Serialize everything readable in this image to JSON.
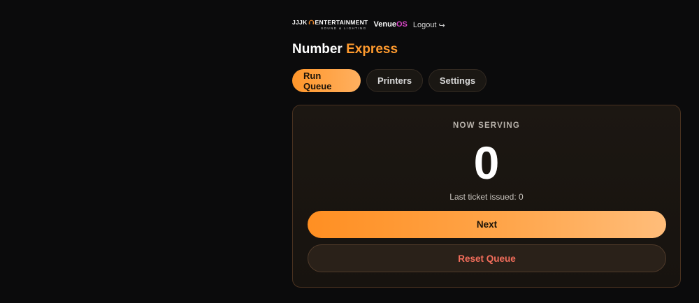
{
  "header": {
    "logo_main_left": "JJJK",
    "logo_main_right": "ENTERTAINMENT",
    "logo_sub": "SOUND & LIGHTING",
    "venue_prefix": "Venue",
    "venue_suffix": "OS",
    "logout_label": "Logout",
    "logout_icon": "↪"
  },
  "title": {
    "main": "Number",
    "accent": "Express"
  },
  "tabs": [
    {
      "label": "Run Queue",
      "active": true
    },
    {
      "label": "Printers",
      "active": false
    },
    {
      "label": "Settings",
      "active": false
    }
  ],
  "panel": {
    "now_serving_label": "NOW SERVING",
    "current_number": "0",
    "last_ticket": "Last ticket issued: 0",
    "next_button": "Next",
    "reset_button": "Reset Queue"
  },
  "colors": {
    "accent": "#ff9a2e",
    "background": "#0b0b0c",
    "os_accent": "#d946c8",
    "danger": "#f26d5b"
  },
  "icons": {
    "logo": "headphone-icon",
    "logout": "logout-arrow-icon"
  }
}
